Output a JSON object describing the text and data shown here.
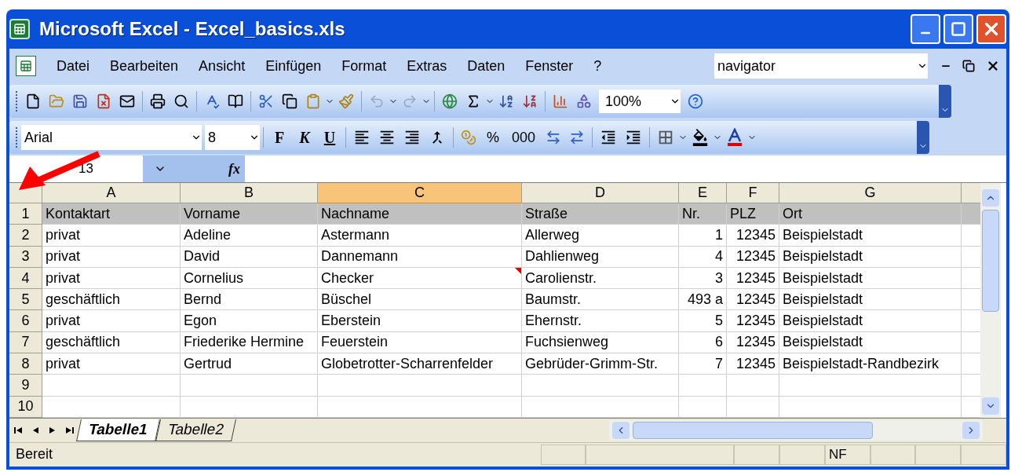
{
  "window": {
    "title": "Microsoft Excel - Excel_basics.xls"
  },
  "menu": {
    "items": [
      "Datei",
      "Bearbeiten",
      "Ansicht",
      "Einfügen",
      "Format",
      "Extras",
      "Daten",
      "Fenster",
      "?"
    ],
    "help_box": {
      "value": "navigator"
    }
  },
  "standard_toolbar": {
    "zoom": "100%"
  },
  "format_toolbar": {
    "font": "Arial",
    "size": "8",
    "style_buttons": [
      "F",
      "K",
      "U"
    ],
    "number_buttons": [
      "%",
      "000"
    ]
  },
  "formula_bar": {
    "name_box": "13",
    "fx": "fx"
  },
  "columns": [
    {
      "label": "A",
      "selected": false,
      "kind": "text"
    },
    {
      "label": "B",
      "selected": false,
      "kind": "text"
    },
    {
      "label": "C",
      "selected": true,
      "kind": "text"
    },
    {
      "label": "D",
      "selected": false,
      "kind": "text"
    },
    {
      "label": "E",
      "selected": false,
      "kind": "number"
    },
    {
      "label": "F",
      "selected": false,
      "kind": "number"
    },
    {
      "label": "G",
      "selected": false,
      "kind": "text"
    }
  ],
  "rows": [
    {
      "number": "1",
      "kind": "header",
      "cells": [
        "Kontaktart",
        "Vorname",
        "Nachname",
        "Straße",
        "Nr.",
        "PLZ",
        "Ort"
      ]
    },
    {
      "number": "2",
      "kind": "data",
      "cells": [
        "privat",
        "Adeline",
        "Astermann",
        "Allerweg",
        "1",
        "12345",
        "Beispielstadt"
      ]
    },
    {
      "number": "3",
      "kind": "data",
      "cells": [
        "privat",
        "David",
        "Dannemann",
        "Dahlienweg",
        "4",
        "12345",
        "Beispielstadt"
      ]
    },
    {
      "number": "4",
      "kind": "data",
      "cells": [
        "privat",
        "Cornelius",
        {
          "text": "Checker",
          "comment": true
        },
        "Carolienstr.",
        "3",
        "12345",
        "Beispielstadt"
      ]
    },
    {
      "number": "5",
      "kind": "data",
      "cells": [
        "geschäftlich",
        "Bernd",
        "Büschel",
        "Baumstr.",
        "493 a",
        "12345",
        "Beispielstadt"
      ]
    },
    {
      "number": "6",
      "kind": "data",
      "cells": [
        "privat",
        "Egon",
        "Eberstein",
        "Ehernstr.",
        "5",
        "12345",
        "Beispielstadt"
      ]
    },
    {
      "number": "7",
      "kind": "data",
      "cells": [
        "geschäftlich",
        "Friederike Hermine",
        "Feuerstein",
        "Fuchsienweg",
        "6",
        "12345",
        "Beispielstadt"
      ]
    },
    {
      "number": "8",
      "kind": "data",
      "cells": [
        "privat",
        "Gertrud",
        "Globetrotter-Scharrenfelder",
        "Gebrüder-Grimm-Str.",
        "7",
        "12345",
        "Beispielstadt-Randbezirk"
      ]
    },
    {
      "number": "9",
      "kind": "empty",
      "cells": []
    },
    {
      "number": "10",
      "kind": "empty",
      "cells": []
    }
  ],
  "sheet_tabs": [
    {
      "label": "Tabelle1",
      "selected": true
    },
    {
      "label": "Tabelle2",
      "selected": false
    }
  ],
  "status_bar": {
    "status": "Bereit",
    "indicator": "NF"
  }
}
